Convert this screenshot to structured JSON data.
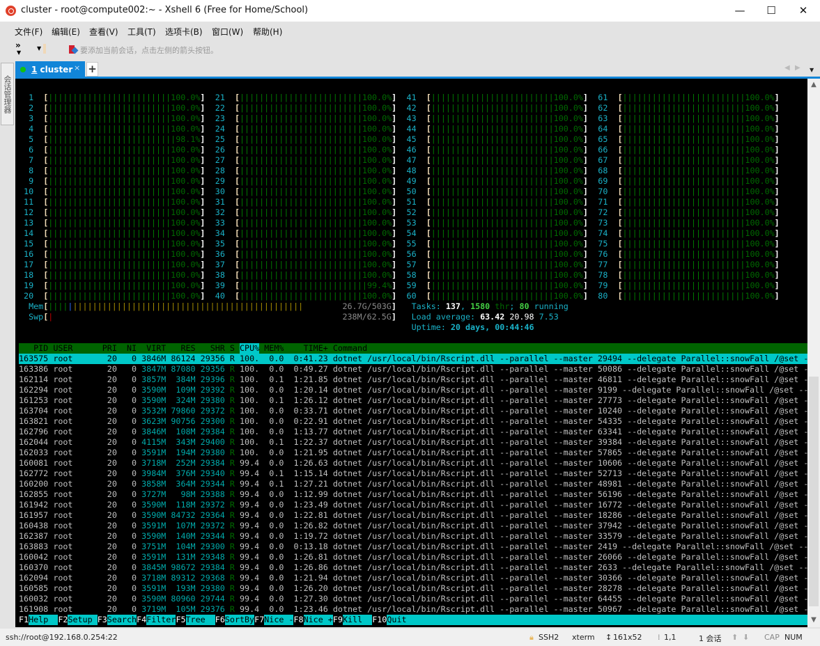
{
  "window": {
    "title": "cluster - root@compute002:~ - Xshell 6 (Free for Home/School)",
    "minimize": "—",
    "maximize": "☐",
    "close": "✕"
  },
  "menu": [
    "文件(F)",
    "编辑(E)",
    "查看(V)",
    "工具(T)",
    "选项卡(B)",
    "窗口(W)",
    "帮助(H)"
  ],
  "toolbar": {
    "hint": "要添加当前会话，点击左侧的箭头按钮。",
    "expand": "»"
  },
  "sidestrip": "会话管理器",
  "tab": {
    "number": "1",
    "label": " cluster",
    "close": "×",
    "add": "+"
  },
  "htop": {
    "cpu_labels": [
      "1",
      "2",
      "3",
      "4",
      "5",
      "6",
      "7",
      "8",
      "9",
      "10",
      "11",
      "12",
      "13",
      "14",
      "15",
      "16",
      "17",
      "18",
      "19",
      "20",
      "21",
      "22",
      "23",
      "24",
      "25",
      "26",
      "27",
      "28",
      "29",
      "30",
      "31",
      "32",
      "33",
      "34",
      "35",
      "36",
      "37",
      "38",
      "39",
      "40",
      "41",
      "42",
      "43",
      "44",
      "45",
      "46",
      "47",
      "48",
      "49",
      "50",
      "51",
      "52",
      "53",
      "54",
      "55",
      "56",
      "57",
      "58",
      "59",
      "60",
      "61",
      "62",
      "63",
      "64",
      "65",
      "66",
      "67",
      "68",
      "69",
      "70",
      "71",
      "72",
      "73",
      "74",
      "75",
      "76",
      "77",
      "78",
      "79",
      "80"
    ],
    "cpu_percents": [
      "100.0%",
      "100.0%",
      "100.0%",
      "100.0%",
      "98.1%",
      "100.0%",
      "100.0%",
      "100.0%",
      "100.0%",
      "100.0%",
      "100.0%",
      "100.0%",
      "100.0%",
      "100.0%",
      "100.0%",
      "100.0%",
      "100.0%",
      "100.0%",
      "100.0%",
      "100.0%",
      "100.0%",
      "100.0%",
      "100.0%",
      "100.0%",
      "100.0%",
      "100.0%",
      "100.0%",
      "100.0%",
      "100.0%",
      "100.0%",
      "100.0%",
      "100.0%",
      "100.0%",
      "100.0%",
      "100.0%",
      "100.0%",
      "100.0%",
      "100.0%",
      "99.4%",
      "100.0%",
      "100.0%",
      "100.0%",
      "100.0%",
      "100.0%",
      "100.0%",
      "100.0%",
      "100.0%",
      "100.0%",
      "100.0%",
      "100.0%",
      "100.0%",
      "100.0%",
      "100.0%",
      "100.0%",
      "100.0%",
      "100.0%",
      "100.0%",
      "100.0%",
      "100.0%",
      "100.0%",
      "100.0%",
      "100.0%",
      "100.0%",
      "100.0%",
      "100.0%",
      "100.0%",
      "100.0%",
      "100.0%",
      "100.0%",
      "100.0%",
      "100.0%",
      "100.0%",
      "100.0%",
      "100.0%",
      "100.0%",
      "100.0%",
      "100.0%",
      "100.0%",
      "100.0%",
      "100.0%"
    ],
    "mem": {
      "label": "Mem",
      "value": "26.7G/503G",
      "segments": [
        {
          "color": "#007a00",
          "fraction": 0.057
        },
        {
          "color": "#2c6cf0",
          "fraction": 0.014
        },
        {
          "color": "#a89000",
          "fraction": 0.67
        }
      ]
    },
    "swp": {
      "label": "Swp",
      "value": "238M/62.5G",
      "segments": [
        {
          "color": "#c00000",
          "fraction": 0.014
        }
      ]
    },
    "tasks": {
      "label": "Tasks: ",
      "count": "137",
      "sep": ", ",
      "threads": "1580",
      "thr": " thr",
      "semi": "; ",
      "running": "80",
      "running_label": " running"
    },
    "load": {
      "label": "Load average: ",
      "l1": "63.42",
      "l5": "20.98",
      "l15": "7.53"
    },
    "uptime": {
      "label": "Uptime: ",
      "value": "20 days, 00:44:46"
    },
    "columns": [
      "PID",
      "USER",
      "PRI",
      "NI",
      "VIRT",
      "RES",
      "SHR",
      "S",
      "CPU%",
      "MEM%",
      "TIME+",
      "Command"
    ],
    "sort_column": "CPU%",
    "processes": [
      [
        "163575",
        "root",
        "20",
        "0",
        "3846M",
        "86124",
        "29356",
        "R",
        "100.",
        "0.0",
        "0:41.23",
        "dotnet /usr/local/bin/Rscript.dll --parallel --master 29494 --delegate Parallel::snowFall /@set -"
      ],
      [
        "163386",
        "root",
        "20",
        "0",
        "3847M",
        "87080",
        "29356",
        "R",
        "100.",
        "0.0",
        "0:49.27",
        "dotnet /usr/local/bin/Rscript.dll --parallel --master 50086 --delegate Parallel::snowFall /@set -"
      ],
      [
        "162114",
        "root",
        "20",
        "0",
        "3857M",
        "384M",
        "29396",
        "R",
        "100.",
        "0.1",
        "1:21.85",
        "dotnet /usr/local/bin/Rscript.dll --parallel --master 46811 --delegate Parallel::snowFall /@set -"
      ],
      [
        "162294",
        "root",
        "20",
        "0",
        "3590M",
        "109M",
        "29392",
        "R",
        "100.",
        "0.0",
        "1:20.14",
        "dotnet /usr/local/bin/Rscript.dll --parallel --master 9199 --delegate Parallel::snowFall /@set --"
      ],
      [
        "161253",
        "root",
        "20",
        "0",
        "3590M",
        "324M",
        "29380",
        "R",
        "100.",
        "0.1",
        "1:26.12",
        "dotnet /usr/local/bin/Rscript.dll --parallel --master 27773 --delegate Parallel::snowFall /@set -"
      ],
      [
        "163704",
        "root",
        "20",
        "0",
        "3532M",
        "79860",
        "29372",
        "R",
        "100.",
        "0.0",
        "0:33.71",
        "dotnet /usr/local/bin/Rscript.dll --parallel --master 10240 --delegate Parallel::snowFall /@set -"
      ],
      [
        "163821",
        "root",
        "20",
        "0",
        "3623M",
        "90756",
        "29300",
        "R",
        "100.",
        "0.0",
        "0:22.91",
        "dotnet /usr/local/bin/Rscript.dll --parallel --master 54335 --delegate Parallel::snowFall /@set -"
      ],
      [
        "162796",
        "root",
        "20",
        "0",
        "3846M",
        "108M",
        "29384",
        "R",
        "100.",
        "0.0",
        "1:13.77",
        "dotnet /usr/local/bin/Rscript.dll --parallel --master 63341 --delegate Parallel::snowFall /@set -"
      ],
      [
        "162044",
        "root",
        "20",
        "0",
        "4115M",
        "343M",
        "29400",
        "R",
        "100.",
        "0.1",
        "1:22.37",
        "dotnet /usr/local/bin/Rscript.dll --parallel --master 39384 --delegate Parallel::snowFall /@set -"
      ],
      [
        "162033",
        "root",
        "20",
        "0",
        "3591M",
        "194M",
        "29380",
        "R",
        "100.",
        "0.0",
        "1:21.95",
        "dotnet /usr/local/bin/Rscript.dll --parallel --master 57865 --delegate Parallel::snowFall /@set -"
      ],
      [
        "160081",
        "root",
        "20",
        "0",
        "3718M",
        "252M",
        "29384",
        "R",
        "99.4",
        "0.0",
        "1:26.63",
        "dotnet /usr/local/bin/Rscript.dll --parallel --master 10606 --delegate Parallel::snowFall /@set -"
      ],
      [
        "162772",
        "root",
        "20",
        "0",
        "3984M",
        "376M",
        "29340",
        "R",
        "99.4",
        "0.1",
        "1:15.14",
        "dotnet /usr/local/bin/Rscript.dll --parallel --master 52713 --delegate Parallel::snowFall /@set -"
      ],
      [
        "160200",
        "root",
        "20",
        "0",
        "3858M",
        "364M",
        "29344",
        "R",
        "99.4",
        "0.1",
        "1:27.21",
        "dotnet /usr/local/bin/Rscript.dll --parallel --master 48981 --delegate Parallel::snowFall /@set -"
      ],
      [
        "162855",
        "root",
        "20",
        "0",
        "3727M",
        "98M",
        "29388",
        "R",
        "99.4",
        "0.0",
        "1:12.99",
        "dotnet /usr/local/bin/Rscript.dll --parallel --master 56196 --delegate Parallel::snowFall /@set -"
      ],
      [
        "161942",
        "root",
        "20",
        "0",
        "3590M",
        "118M",
        "29372",
        "R",
        "99.4",
        "0.0",
        "1:23.49",
        "dotnet /usr/local/bin/Rscript.dll --parallel --master 16772 --delegate Parallel::snowFall /@set -"
      ],
      [
        "161957",
        "root",
        "20",
        "0",
        "3590M",
        "84732",
        "29364",
        "R",
        "99.4",
        "0.0",
        "1:22.81",
        "dotnet /usr/local/bin/Rscript.dll --parallel --master 18286 --delegate Parallel::snowFall /@set -"
      ],
      [
        "160438",
        "root",
        "20",
        "0",
        "3591M",
        "107M",
        "29372",
        "R",
        "99.4",
        "0.0",
        "1:26.82",
        "dotnet /usr/local/bin/Rscript.dll --parallel --master 37942 --delegate Parallel::snowFall /@set -"
      ],
      [
        "162387",
        "root",
        "20",
        "0",
        "3590M",
        "140M",
        "29344",
        "R",
        "99.4",
        "0.0",
        "1:19.72",
        "dotnet /usr/local/bin/Rscript.dll --parallel --master 33579 --delegate Parallel::snowFall /@set -"
      ],
      [
        "163883",
        "root",
        "20",
        "0",
        "3751M",
        "104M",
        "29300",
        "R",
        "99.4",
        "0.0",
        "0:13.18",
        "dotnet /usr/local/bin/Rscript.dll --parallel --master 2419 --delegate Parallel::snowFall /@set --"
      ],
      [
        "160042",
        "root",
        "20",
        "0",
        "3591M",
        "131M",
        "29348",
        "R",
        "99.4",
        "0.0",
        "1:26.81",
        "dotnet /usr/local/bin/Rscript.dll --parallel --master 26066 --delegate Parallel::snowFall /@set -"
      ],
      [
        "160370",
        "root",
        "20",
        "0",
        "3845M",
        "98672",
        "29384",
        "R",
        "99.4",
        "0.0",
        "1:26.86",
        "dotnet /usr/local/bin/Rscript.dll --parallel --master 2633 --delegate Parallel::snowFall /@set --"
      ],
      [
        "162094",
        "root",
        "20",
        "0",
        "3718M",
        "89312",
        "29368",
        "R",
        "99.4",
        "0.0",
        "1:21.94",
        "dotnet /usr/local/bin/Rscript.dll --parallel --master 30366 --delegate Parallel::snowFall /@set -"
      ],
      [
        "160585",
        "root",
        "20",
        "0",
        "3591M",
        "193M",
        "29380",
        "R",
        "99.4",
        "0.0",
        "1:26.20",
        "dotnet /usr/local/bin/Rscript.dll --parallel --master 28278 --delegate Parallel::snowFall /@set -"
      ],
      [
        "160032",
        "root",
        "20",
        "0",
        "3590M",
        "80960",
        "29744",
        "R",
        "99.4",
        "0.0",
        "1:27.30",
        "dotnet /usr/local/bin/Rscript.dll --parallel --master 64455 --delegate Parallel::snowFall /@set -"
      ],
      [
        "161908",
        "root",
        "20",
        "0",
        "3719M",
        "105M",
        "29376",
        "R",
        "99.4",
        "0.0",
        "1:23.46",
        "dotnet /usr/local/bin/Rscript.dll --parallel --master 50967 --delegate Parallel::snowFall /@set -"
      ]
    ],
    "fkeys": [
      {
        "key": "F1",
        "label": "Help  "
      },
      {
        "key": "F2",
        "label": "Setup "
      },
      {
        "key": "F3",
        "label": "Search"
      },
      {
        "key": "F4",
        "label": "Filter"
      },
      {
        "key": "F5",
        "label": "Tree  "
      },
      {
        "key": "F6",
        "label": "SortBy"
      },
      {
        "key": "F7",
        "label": "Nice -"
      },
      {
        "key": "F8",
        "label": "Nice +"
      },
      {
        "key": "F9",
        "label": "Kill  "
      },
      {
        "key": "F10",
        "label": "Quit"
      }
    ]
  },
  "statusbar": {
    "connection": "ssh://root@192.168.0.254:22",
    "protocol": "SSH2",
    "term": "xterm",
    "size": "161x52",
    "cursor": "1,1",
    "sessions": "1 会话",
    "cap": "CAP",
    "num": "NUM"
  },
  "colors": {
    "accent": "#1185d8",
    "header_bg": "#006400",
    "selected_bg": "#00c8c8"
  }
}
